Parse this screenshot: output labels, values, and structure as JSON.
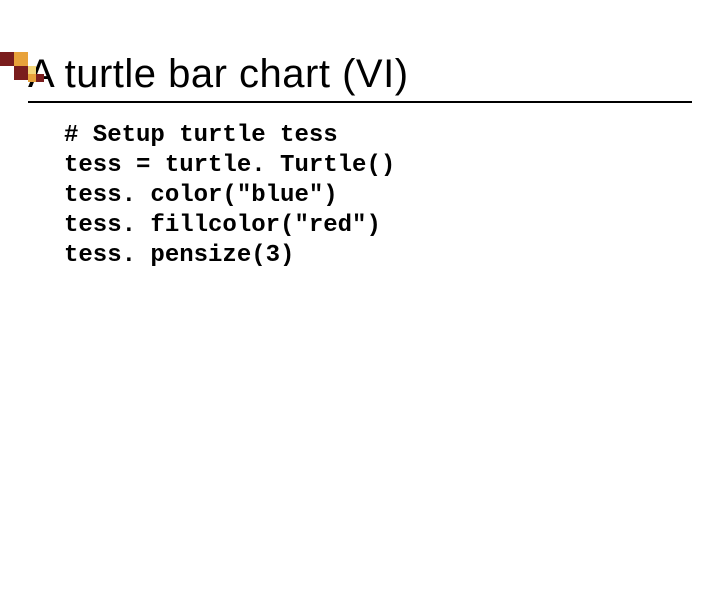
{
  "title": "A turtle bar chart (VI)",
  "code": {
    "l1": "# Setup turtle tess",
    "l2": "tess = turtle. Turtle()",
    "l3": "tess. color(\"blue\")",
    "l4": "tess. fillcolor(\"red\")",
    "l5": "tess. pensize(3)"
  },
  "decor": {
    "colors": {
      "burgundy": "#7a1d1d",
      "orange": "#e8a23a",
      "yellow": "#f4d77a"
    }
  }
}
